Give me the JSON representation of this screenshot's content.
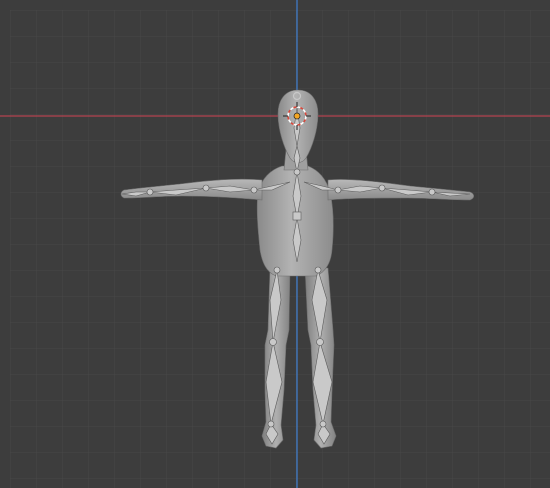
{
  "viewport": {
    "view": "front-orthographic",
    "grid_visible": true,
    "axes": {
      "x": "red",
      "z": "blue"
    },
    "model": {
      "type": "humanoid mesh with armature",
      "pose": "T-pose"
    },
    "cursor_3d": {
      "icon": "3d-cursor-icon",
      "visible": true
    }
  },
  "colors": {
    "background": "#3d3d3d",
    "grid_line": "#484848",
    "x_axis": "#b4424f",
    "z_axis": "#3f7fd1",
    "mesh": "#9c9c9c",
    "mesh_light": "#b8b8b8",
    "mesh_dark": "#7d7d7d",
    "bone": "#c9c9c9",
    "origin": "#f4a623"
  }
}
